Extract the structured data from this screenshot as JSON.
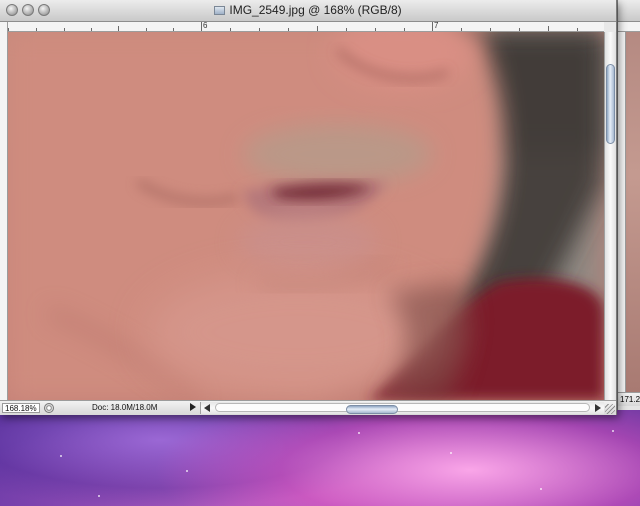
{
  "window": {
    "title": "IMG_2549.jpg @ 168% (RGB/8)"
  },
  "ruler": {
    "top_labels": [
      "6",
      "7"
    ]
  },
  "statusbar": {
    "zoom": "168.18%",
    "doc_size": "Doc: 18.0M/18.0M"
  },
  "second_window": {
    "zoom": "171.2"
  },
  "canvas": {
    "subject": "close-up photo of a face (lips and chin)"
  }
}
